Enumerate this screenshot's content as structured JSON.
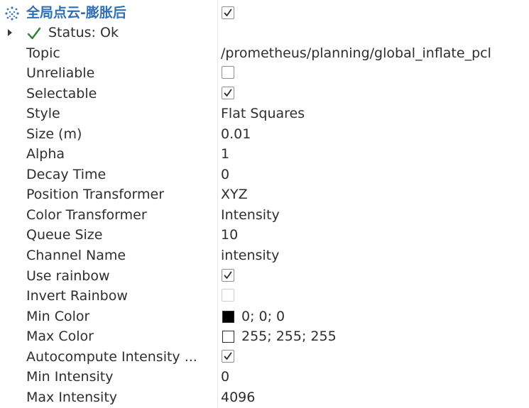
{
  "display": {
    "title": "全局点云-膨胀后",
    "icon": "pointcloud-icon",
    "enabled": true
  },
  "status": {
    "icon": "checkmark-icon",
    "label": "Status: Ok"
  },
  "properties": [
    {
      "name": "Topic",
      "type": "text",
      "value": "/prometheus/planning/global_inflate_pcl"
    },
    {
      "name": "Unreliable",
      "type": "checkbox",
      "checked": false,
      "disabled": false
    },
    {
      "name": "Selectable",
      "type": "checkbox",
      "checked": true,
      "disabled": false
    },
    {
      "name": "Style",
      "type": "text",
      "value": "Flat Squares"
    },
    {
      "name": "Size (m)",
      "type": "text",
      "value": "0.01"
    },
    {
      "name": "Alpha",
      "type": "text",
      "value": "1"
    },
    {
      "name": "Decay Time",
      "type": "text",
      "value": "0"
    },
    {
      "name": "Position Transformer",
      "type": "text",
      "value": "XYZ"
    },
    {
      "name": "Color Transformer",
      "type": "text",
      "value": "Intensity"
    },
    {
      "name": "Queue Size",
      "type": "text",
      "value": "10"
    },
    {
      "name": "Channel Name",
      "type": "text",
      "value": "intensity"
    },
    {
      "name": "Use rainbow",
      "type": "checkbox",
      "checked": true,
      "disabled": false
    },
    {
      "name": "Invert Rainbow",
      "type": "checkbox",
      "checked": false,
      "disabled": true
    },
    {
      "name": "Min Color",
      "type": "color",
      "value": "0; 0; 0",
      "swatch": "#000000"
    },
    {
      "name": "Max Color",
      "type": "color",
      "value": "255; 255; 255",
      "swatch": "#ffffff"
    },
    {
      "name": "Autocompute Intensity ...",
      "type": "checkbox",
      "checked": true,
      "disabled": false
    },
    {
      "name": "Min Intensity",
      "type": "text",
      "value": "0"
    },
    {
      "name": "Max Intensity",
      "type": "text",
      "value": "4096"
    }
  ],
  "colors": {
    "title": "#2f6fb3",
    "status_check": "#2e7d32",
    "text": "#2e2e2e"
  }
}
